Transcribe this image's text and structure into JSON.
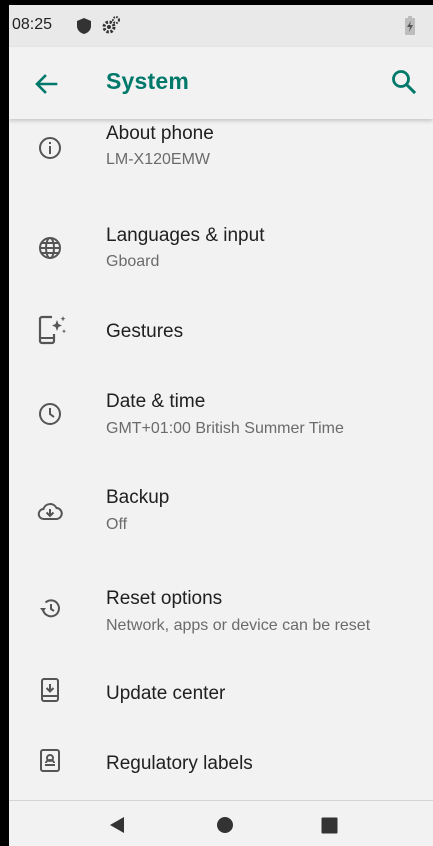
{
  "status_bar": {
    "time": "08:25",
    "icons": [
      "shield-icon",
      "settings-gear-icon",
      "battery-charging-icon"
    ]
  },
  "app_bar": {
    "title": "System",
    "back_icon": "arrow-back-icon",
    "search_icon": "search-icon",
    "accent_color": "#00796b"
  },
  "settings": [
    {
      "icon": "info-icon",
      "title": "About phone",
      "subtitle": "LM-X120EMW"
    },
    {
      "icon": "globe-icon",
      "title": "Languages & input",
      "subtitle": "Gboard"
    },
    {
      "icon": "gestures-phone-icon",
      "title": "Gestures",
      "subtitle": ""
    },
    {
      "icon": "clock-icon",
      "title": "Date & time",
      "subtitle": "GMT+01:00 British Summer Time"
    },
    {
      "icon": "cloud-backup-icon",
      "title": "Backup",
      "subtitle": "Off"
    },
    {
      "icon": "history-reset-icon",
      "title": "Reset options",
      "subtitle": "Network, apps or device can be reset"
    },
    {
      "icon": "system-update-icon",
      "title": "Update center",
      "subtitle": ""
    },
    {
      "icon": "regulatory-badge-icon",
      "title": "Regulatory labels",
      "subtitle": ""
    }
  ],
  "nav_bar": {
    "buttons": [
      "back-triangle-icon",
      "home-circle-icon",
      "recents-square-icon"
    ]
  }
}
